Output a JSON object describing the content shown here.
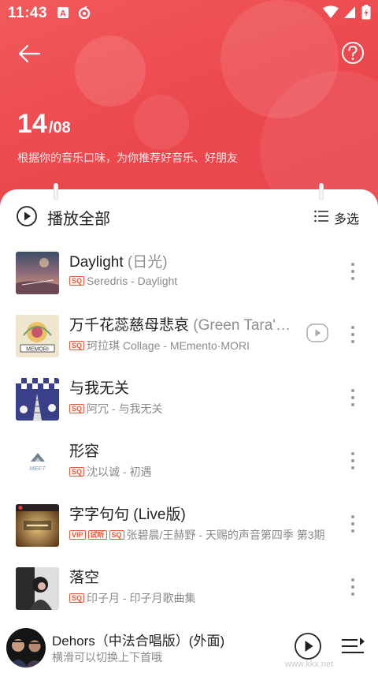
{
  "status": {
    "time": "11:43"
  },
  "header": {
    "date_day": "14",
    "date_month": "/08",
    "subtitle": "根据你的音乐口味，为你推荐好音乐、好朋友"
  },
  "toolbar": {
    "play_all": "播放全部",
    "multi_select": "多选"
  },
  "songs": [
    {
      "title": "Daylight",
      "alias": " (日光)",
      "tags": [
        "SQ"
      ],
      "meta": "Seredris - Daylight",
      "has_mv": false
    },
    {
      "title": "万千花蕊慈母悲哀",
      "alias": " (Green Tara'…",
      "tags": [
        "SQ"
      ],
      "meta": "珂拉琪 Collage - MEmento·MORI",
      "has_mv": true
    },
    {
      "title": "与我无关",
      "alias": "",
      "tags": [
        "SQ"
      ],
      "meta": "阿冗 - 与我无关",
      "has_mv": false
    },
    {
      "title": "形容",
      "alias": "",
      "tags": [
        "SQ"
      ],
      "meta": "沈以诚 - 初遇",
      "has_mv": false
    },
    {
      "title": "字字句句 (Live版)",
      "alias": "",
      "tags": [
        "VIP",
        "试听",
        "SQ"
      ],
      "meta": "张碧晨/王赫野 - 天赐的声音第四季 第3期",
      "has_mv": false
    },
    {
      "title": "落空",
      "alias": "",
      "tags": [
        "SQ"
      ],
      "meta": "印子月 - 印子月歌曲集",
      "has_mv": false
    }
  ],
  "mini_player": {
    "title": "Dehors（中法合唱版）(外面)",
    "subtitle": "横滑可以切换上下首哦"
  },
  "watermark": "www.kkx.net",
  "colors": {
    "accent": "#ec4a4f",
    "tag": "#e65a3a"
  }
}
